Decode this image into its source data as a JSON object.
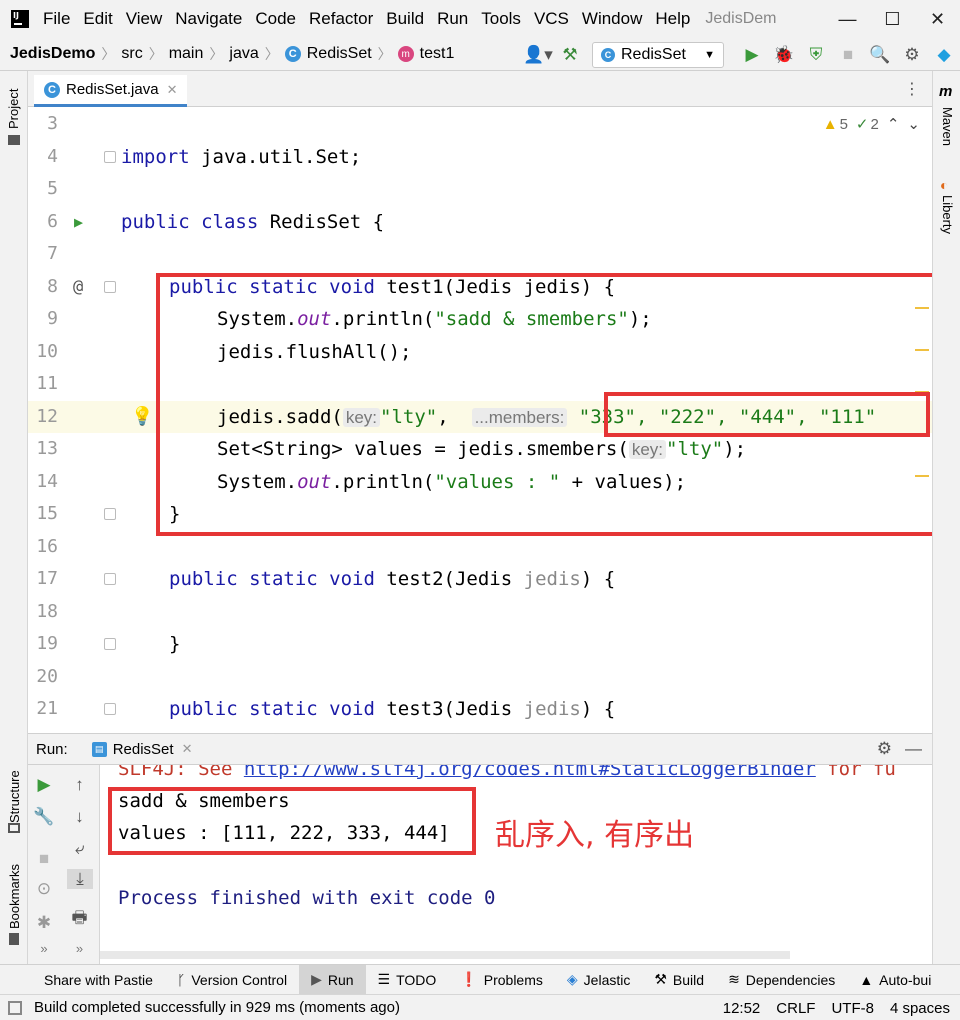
{
  "menubar": {
    "logo": "IJ",
    "items": [
      "File",
      "Edit",
      "View",
      "Navigate",
      "Code",
      "Refactor",
      "Build",
      "Run",
      "Tools",
      "VCS",
      "Window",
      "Help"
    ],
    "title": "JedisDem"
  },
  "navbar": {
    "crumbs": [
      "JedisDemo",
      "src",
      "main",
      "java",
      "RedisSet",
      "test1"
    ],
    "run_config": "RedisSet"
  },
  "side_tabs": {
    "left_project": "Project",
    "left_structure": "Structure",
    "left_bookmarks": "Bookmarks",
    "right_maven": "Maven",
    "right_liberty": "Liberty"
  },
  "editor": {
    "tab": "RedisSet.java",
    "warnings": "5",
    "weak_warnings": "2",
    "lines": [
      {
        "n": "3"
      },
      {
        "n": "4"
      },
      {
        "n": "5"
      },
      {
        "n": "6"
      },
      {
        "n": "7"
      },
      {
        "n": "8"
      },
      {
        "n": "9"
      },
      {
        "n": "10"
      },
      {
        "n": "11"
      },
      {
        "n": "12"
      },
      {
        "n": "13"
      },
      {
        "n": "14"
      },
      {
        "n": "15"
      },
      {
        "n": "16"
      },
      {
        "n": "17"
      },
      {
        "n": "18"
      },
      {
        "n": "19"
      },
      {
        "n": "20"
      },
      {
        "n": "21"
      }
    ],
    "code": {
      "l4_kw": "import",
      "l4_rest": " java.util.Set;",
      "l6_kw": "public class",
      "l6_rest": " RedisSet {",
      "l8_kw": "public static void",
      "l8_rest": " test1(Jedis jedis) {",
      "l9_a": "System.",
      "l9_out": "out",
      "l9_b": ".println(",
      "l9_str": "\"sadd & smembers\"",
      "l9_c": ");",
      "l10": "jedis.flushAll();",
      "l12_a": "jedis.sadd(",
      "l12_hint1": "key:",
      "l12_str1": "\"lty\"",
      "l12_b": ",  ",
      "l12_hint2": "...members:",
      "l12_vals": "\"333\", \"222\", \"444\", \"111\"",
      "l13_a": "Set<String> values = jedis.smembers(",
      "l13_hint": "key:",
      "l13_str": "\"lty\"",
      "l13_b": ");",
      "l14_a": "System.",
      "l14_out": "out",
      "l14_b": ".println(",
      "l14_str": "\"values : \"",
      "l14_c": " + values);",
      "l15": "}",
      "l17_kw": "public static void",
      "l17_a": " test2(Jedis ",
      "l17_p": "jedis",
      "l17_b": ") {",
      "l19": "}",
      "l21_kw": "public static void",
      "l21_a": " test3(Jedis ",
      "l21_p": "jedis",
      "l21_b": ") {"
    }
  },
  "run_panel": {
    "label": "Run:",
    "tab": "RedisSet",
    "console": {
      "slf4j_a": "SLF4J: See ",
      "slf4j_link": "http://www.slf4j.org/codes.html#StaticLoggerBinder",
      "slf4j_b": " for fu",
      "out1": "sadd & smembers",
      "out2": "values : [111, 222, 333, 444]",
      "exit": "Process finished with exit code 0"
    },
    "annotation": "乱序入, 有序出"
  },
  "tool_windows": [
    "Share with Pastie",
    "Version Control",
    "Run",
    "TODO",
    "Problems",
    "Jelastic",
    "Build",
    "Dependencies",
    "Auto-bui"
  ],
  "statusbar": {
    "message": "Build completed successfully in 929 ms (moments ago)",
    "position": "12:52",
    "line_sep": "CRLF",
    "encoding": "UTF-8",
    "indent": "4 spaces"
  },
  "colors": {
    "highlight_red": "#e53535",
    "keyword": "#1a1aa6",
    "string": "#1b7b18"
  }
}
